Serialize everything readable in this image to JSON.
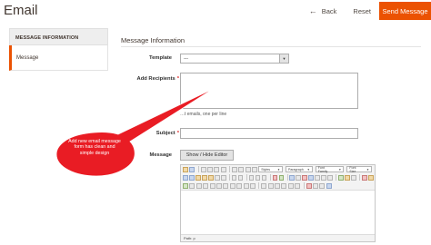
{
  "header": {
    "title": "Email",
    "back_label": "Back",
    "reset_label": "Reset",
    "send_label": "Send Message"
  },
  "sidebar": {
    "heading": "MESSAGE INFORMATION",
    "items": [
      {
        "label": "Message"
      }
    ]
  },
  "form": {
    "section_title": "Message Information",
    "template": {
      "label": "Template",
      "value": "---"
    },
    "recipients": {
      "label": "Add Recipients",
      "hint": "…t emails, one per line"
    },
    "subject": {
      "label": "Subject",
      "value": ""
    },
    "message": {
      "label": "Message",
      "toggle_label": "Show / Hide Editor"
    }
  },
  "editor": {
    "style_select": "Styles",
    "paragraph_select": "Paragraph",
    "font_family_select": "Font Family",
    "font_size_select": "Font Size",
    "status_path": "Path: p"
  },
  "callout": {
    "text": "Add new email message form has clean and simple design",
    "color": "#e91c24"
  },
  "colors": {
    "accent": "#eb5202",
    "required": "#e22626"
  }
}
